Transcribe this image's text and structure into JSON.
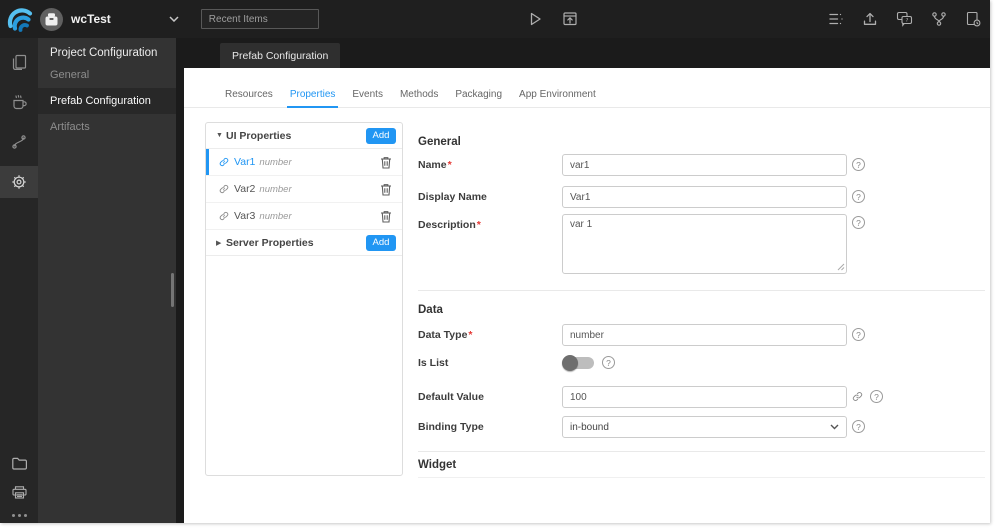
{
  "colors": {
    "accent": "#2196f3",
    "topbar_bg": "#1f1f1f",
    "rail_bg": "#262626",
    "nav_bg": "#333333",
    "strip_bg": "#1b1b1b"
  },
  "topbar": {
    "project": "wcTest",
    "recent_items_placeholder": "Recent Items"
  },
  "icons": {
    "topbar_left": [
      "wavemaker-logo",
      "project-avatar",
      "chevron-down-icon"
    ],
    "topbar_center": [
      "run-icon",
      "preview-icon"
    ],
    "topbar_right": [
      "preferences-list-icon",
      "export-icon",
      "feedback-icon",
      "branch-icon",
      "file-backup-icon"
    ],
    "rail_top": [
      "pages-icon",
      "services-icon",
      "apis-icon",
      "settings-icon"
    ],
    "rail_bottom": [
      "file-explorer-icon",
      "console-icon",
      "more-icon"
    ]
  },
  "nav": {
    "title": "Project Configuration",
    "items": [
      {
        "label": "General",
        "active": false
      },
      {
        "label": "Prefab Configuration",
        "active": true
      },
      {
        "label": "Artifacts",
        "active": false
      }
    ]
  },
  "doc_tab": {
    "label": "Prefab Configuration"
  },
  "tabs": [
    {
      "label": "Resources",
      "active": false
    },
    {
      "label": "Properties",
      "active": true
    },
    {
      "label": "Events",
      "active": false
    },
    {
      "label": "Methods",
      "active": false
    },
    {
      "label": "Packaging",
      "active": false
    },
    {
      "label": "App Environment",
      "active": false
    }
  ],
  "properties_panel": {
    "ui_group": {
      "arrow": "▼",
      "label": "UI Properties",
      "add_label": "Add",
      "items": [
        {
          "name": "Var1",
          "type": "number",
          "selected": true
        },
        {
          "name": "Var2",
          "type": "number",
          "selected": false
        },
        {
          "name": "Var3",
          "type": "number",
          "selected": false
        }
      ]
    },
    "server_group": {
      "arrow": "▶",
      "label": "Server Properties",
      "add_label": "Add"
    }
  },
  "form": {
    "required_mark": "*",
    "help_glyph": "?",
    "general": {
      "title": "General",
      "name": {
        "label": "Name",
        "required": true,
        "value": "var1"
      },
      "display_name": {
        "label": "Display Name",
        "required": false,
        "value": "Var1"
      },
      "description": {
        "label": "Description",
        "required": true,
        "value": "var 1"
      }
    },
    "data": {
      "title": "Data",
      "data_type": {
        "label": "Data Type",
        "required": true,
        "value": "number"
      },
      "is_list": {
        "label": "Is List",
        "state": "off"
      },
      "default_value": {
        "label": "Default Value",
        "value": "100"
      },
      "binding_type": {
        "label": "Binding Type",
        "value": "in-bound"
      }
    },
    "widget": {
      "title": "Widget"
    }
  }
}
